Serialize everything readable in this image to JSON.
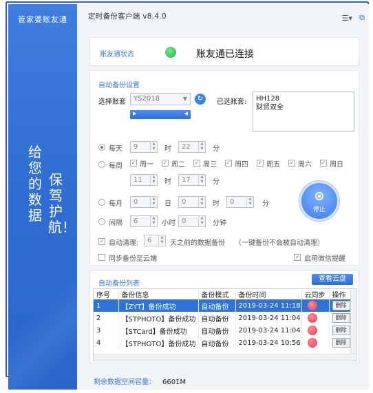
{
  "app": {
    "name": "管家婆账友通",
    "slogan_col1": "给您的数据",
    "slogan_col2": "保驾护航！"
  },
  "window": {
    "title": "定时备份客户端 v8.4.0"
  },
  "status": {
    "label": "账友通状态",
    "text": "账友通已连接",
    "color": "#27b64a"
  },
  "settings": {
    "section_label": "自动备份设置",
    "select_label": "选择账套",
    "select_value": "YS2018",
    "selected_label": "已选账套:",
    "selected_value": "HH128\n财贸双全",
    "daily": {
      "label": "每天",
      "hour": "9",
      "hour_unit": "时",
      "minute": "22",
      "minute_unit": "分"
    },
    "weekly": {
      "label": "每周",
      "days": [
        "周一",
        "周二",
        "周三",
        "周四",
        "周五",
        "周六",
        "周日"
      ],
      "hour": "11",
      "hour_unit": "时",
      "minute": "17",
      "minute_unit": "分"
    },
    "monthly": {
      "label": "每月",
      "day": "0",
      "day_unit": "日",
      "hour": "0",
      "hour_unit": "时",
      "minute": "0",
      "minute_unit": "分"
    },
    "interval": {
      "label": "间隔",
      "hours": "6",
      "hours_unit": "小时",
      "minutes": "0",
      "minutes_unit": "分钟"
    },
    "auto_clean": {
      "label": "自动清理:",
      "days": "6",
      "suffix": "天之前的数据备份",
      "note": "（一键备份不会被自动清理）"
    },
    "sync_cloud_label": "同步备份至云端",
    "wechat_label": "启用微信提醒",
    "stop_label": "停止"
  },
  "backup_list": {
    "section_label": "自动备份列表",
    "cloud_button": "查看云盘",
    "columns": [
      "序号",
      "备份信息",
      "备份模式",
      "备份时间",
      "云同步",
      "操作"
    ],
    "rows": [
      {
        "no": "1",
        "info": "【ZYT】备份成功",
        "mode": "自动备份",
        "time": "2019-03-24 11:18",
        "action": "删除"
      },
      {
        "no": "2",
        "info": "【STPHOTO】备份成功",
        "mode": "自动备份",
        "time": "2019-03-24 11:04",
        "action": "删除"
      },
      {
        "no": "3",
        "info": "【STCard】备份成功",
        "mode": "自动备份",
        "time": "2019-03-24 11:04",
        "action": "删除"
      },
      {
        "no": "4",
        "info": "【STPHOTO】备份成功",
        "mode": "自动备份",
        "time": "2019-03-24 10:56",
        "action": "删除"
      }
    ]
  },
  "footer": {
    "label": "剩余数据空间容量：",
    "value": "6601M"
  },
  "icons": {
    "menu": "menu-icon",
    "restore": "restore-window-icon",
    "refresh": "refresh-icon",
    "stop": "stop-icon"
  }
}
